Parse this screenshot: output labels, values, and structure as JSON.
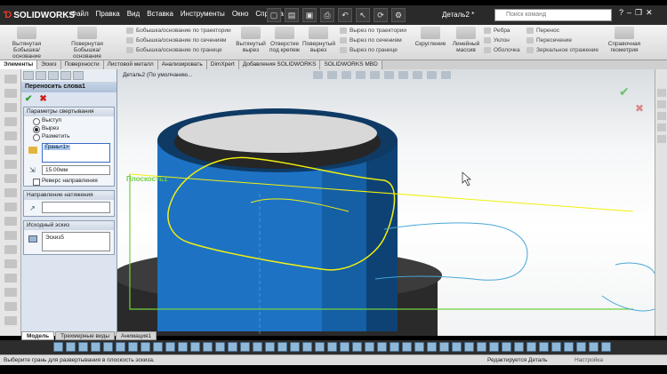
{
  "app": {
    "logo_text": "SOLIDWORKS",
    "document_title": "Деталь2 *",
    "search_placeholder": "Поиск команд"
  },
  "menu": [
    "Файл",
    "Правка",
    "Вид",
    "Вставка",
    "Инструменты",
    "Окно",
    "Справка"
  ],
  "ribbon": {
    "big": [
      "Вытянутая Бобышка/основание",
      "Повернутая Бобышка/основание",
      "Вытянутый вырез",
      "Отверстие под крепеж",
      "Повернутый вырез",
      "Скругление",
      "Линейный массив",
      "Справочная геометрия"
    ],
    "small": [
      "Бобышка/основание по траектории",
      "Бобышка/основание по сечениям",
      "Бобышка/основание по границе",
      "Вырез по траектории",
      "Вырез по сечениям",
      "Вырез по границе",
      "Ребра",
      "Уклон",
      "Оболочка",
      "Перенос",
      "Пересечение",
      "Зеркальное отражение"
    ]
  },
  "tabs": [
    "Элементы",
    "Эскиз",
    "Поверхности",
    "Листовой металл",
    "Анализировать",
    "DimXpert",
    "Добавления SOLIDWORKS",
    "SOLIDWORKS MBD"
  ],
  "property_manager": {
    "title": "Переносить слова1",
    "group1": {
      "header": "Параметры свертывания",
      "options": [
        "Выступ",
        "Вырез",
        "Разметить"
      ],
      "selected_index": 1,
      "face_value": "Грань<1>",
      "depth": "15.00мм",
      "reverse_label": "Реверс направления"
    },
    "group2": {
      "header": "Направление натяжения"
    },
    "group3": {
      "header": "Исходный эскиз",
      "sketch": "Эскиз5"
    }
  },
  "graphics": {
    "breadcrumb": "Деталь2 (По умолчанию...",
    "plane_label": "Плоскость1"
  },
  "bottom_tabs": [
    "Модель",
    "Трехмерные виды",
    "Анимация1"
  ],
  "status": {
    "message": "Выберите грань для развертывания в плоскость эскиза.",
    "mode": "Редактируется Деталь",
    "units": "Настройка"
  },
  "colors": {
    "cylinder": "#1d72c4",
    "sketch_yellow": "#f0f010",
    "plane_green": "#70d040",
    "ok_green": "#2b9b2b",
    "cancel_red": "#d02020"
  }
}
